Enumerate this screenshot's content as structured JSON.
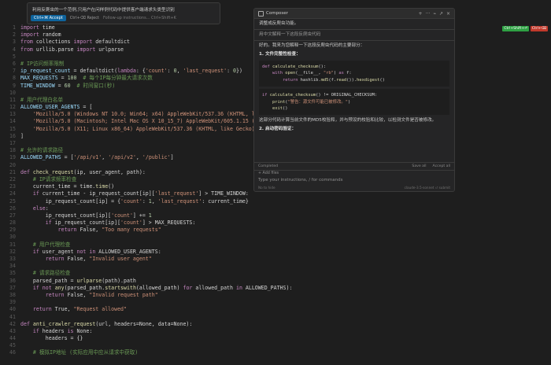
{
  "inline_prompt": {
    "question": "利用反爬虫的一个范例,只用户在问样例代码中提供客户端请求头类型识别",
    "accept_label": "Ctrl+⌘ Accept",
    "reject_label": "Ctrl+⌫ Reject",
    "followup_placeholder": "Follow-up instructions... Ctrl+Shift+K"
  },
  "diff_badges": {
    "accept": "Ctrl+Shift+⏎",
    "reject": "Ctrl+⌫"
  },
  "code_lines": [
    {
      "n": "1",
      "parts": [
        [
          "kw",
          "import"
        ],
        [
          "plain",
          " time"
        ]
      ]
    },
    {
      "n": "2",
      "parts": [
        [
          "kw",
          "import"
        ],
        [
          "plain",
          " random"
        ]
      ]
    },
    {
      "n": "3",
      "parts": [
        [
          "kw",
          "from"
        ],
        [
          "plain",
          " collections "
        ],
        [
          "kw",
          "import"
        ],
        [
          "plain",
          " defaultdict"
        ]
      ]
    },
    {
      "n": "4",
      "parts": [
        [
          "kw",
          "from"
        ],
        [
          "plain",
          " urllib.parse "
        ],
        [
          "kw",
          "import"
        ],
        [
          "plain",
          " urlparse"
        ]
      ]
    },
    {
      "n": "5",
      "parts": []
    },
    {
      "n": "6",
      "parts": [
        [
          "cm",
          "# IP访问频率限制"
        ]
      ]
    },
    {
      "n": "7",
      "parts": [
        [
          "var",
          "ip_request_count"
        ],
        [
          "plain",
          " = defaultdict("
        ],
        [
          "kw",
          "lambda"
        ],
        [
          "plain",
          ": {"
        ],
        [
          "str",
          "'count'"
        ],
        [
          "plain",
          ": "
        ],
        [
          "num",
          "0"
        ],
        [
          "plain",
          ", "
        ],
        [
          "str",
          "'last_request'"
        ],
        [
          "plain",
          ": "
        ],
        [
          "num",
          "0"
        ],
        [
          "plain",
          "})"
        ]
      ]
    },
    {
      "n": "8",
      "parts": [
        [
          "var",
          "MAX_REQUESTS"
        ],
        [
          "plain",
          " = "
        ],
        [
          "num",
          "100"
        ],
        [
          "cm",
          "  # 每个IP每分钟最大请求次数"
        ]
      ]
    },
    {
      "n": "9",
      "parts": [
        [
          "var",
          "TIME_WINDOW"
        ],
        [
          "plain",
          " = "
        ],
        [
          "num",
          "60"
        ],
        [
          "cm",
          "  # 时间窗口(秒)"
        ]
      ]
    },
    {
      "n": "10",
      "parts": []
    },
    {
      "n": "11",
      "parts": [
        [
          "cm",
          "# 用户代理白名单"
        ]
      ]
    },
    {
      "n": "12",
      "parts": [
        [
          "var",
          "ALLOWED_USER_AGENTS"
        ],
        [
          "plain",
          " = ["
        ]
      ]
    },
    {
      "n": "13",
      "parts": [
        [
          "str",
          "    'Mozilla/5.0 (Windows NT 10.0; Win64; x64) AppleWebKit/537.36 (KHTML, lik"
        ]
      ]
    },
    {
      "n": "14",
      "parts": [
        [
          "str",
          "    'Mozilla/5.0 (Macintosh; Intel Mac OS X 10_15_7) AppleWebKit/605.1.15 (KH"
        ]
      ]
    },
    {
      "n": "15",
      "parts": [
        [
          "str",
          "    'Mozilla/5.0 (X11; Linux x86_64) AppleWebKit/537.36 (KHTML, like Gecko) C"
        ]
      ]
    },
    {
      "n": "16",
      "parts": [
        [
          "plain",
          "]"
        ]
      ]
    },
    {
      "n": "17",
      "parts": []
    },
    {
      "n": "18",
      "parts": [
        [
          "cm",
          "# 允许的请求路径"
        ]
      ]
    },
    {
      "n": "19",
      "parts": [
        [
          "var",
          "ALLOWED_PATHS"
        ],
        [
          "plain",
          " = ["
        ],
        [
          "str",
          "'/api/v1'"
        ],
        [
          "plain",
          ", "
        ],
        [
          "str",
          "'/api/v2'"
        ],
        [
          "plain",
          ", "
        ],
        [
          "str",
          "'/public'"
        ],
        [
          "plain",
          "]"
        ]
      ]
    },
    {
      "n": "20",
      "parts": []
    },
    {
      "n": "21",
      "parts": [
        [
          "kw",
          "def"
        ],
        [
          "plain",
          " "
        ],
        [
          "fn",
          "check_request"
        ],
        [
          "plain",
          "(ip, user_agent, path):"
        ]
      ]
    },
    {
      "n": "22",
      "parts": [
        [
          "cm",
          "    # IP请求频率检查"
        ]
      ]
    },
    {
      "n": "23",
      "parts": [
        [
          "plain",
          "    current_time = time."
        ],
        [
          "fn",
          "time"
        ],
        [
          "plain",
          "()"
        ]
      ]
    },
    {
      "n": "24",
      "parts": [
        [
          "kw",
          "    if"
        ],
        [
          "plain",
          " current_time - ip_request_count[ip]["
        ],
        [
          "str",
          "'last_request'"
        ],
        [
          "plain",
          "] > TIME_WINDOW:"
        ]
      ]
    },
    {
      "n": "25",
      "parts": [
        [
          "plain",
          "        ip_request_count[ip] = {"
        ],
        [
          "str",
          "'count'"
        ],
        [
          "plain",
          ": "
        ],
        [
          "num",
          "1"
        ],
        [
          "plain",
          ", "
        ],
        [
          "str",
          "'last_request'"
        ],
        [
          "plain",
          ": current_time}"
        ]
      ]
    },
    {
      "n": "26",
      "parts": [
        [
          "kw",
          "    else"
        ],
        [
          "plain",
          ":"
        ]
      ]
    },
    {
      "n": "27",
      "parts": [
        [
          "plain",
          "        ip_request_count[ip]["
        ],
        [
          "str",
          "'count'"
        ],
        [
          "plain",
          "] += "
        ],
        [
          "num",
          "1"
        ]
      ]
    },
    {
      "n": "28",
      "parts": [
        [
          "kw",
          "        if"
        ],
        [
          "plain",
          " ip_request_count[ip]["
        ],
        [
          "str",
          "'count'"
        ],
        [
          "plain",
          "] > MAX_REQUESTS:"
        ]
      ]
    },
    {
      "n": "29",
      "parts": [
        [
          "kw",
          "            return"
        ],
        [
          "plain",
          " False, "
        ],
        [
          "str",
          "\"Too many requests\""
        ]
      ]
    },
    {
      "n": "30",
      "parts": []
    },
    {
      "n": "31",
      "parts": [
        [
          "cm",
          "    # 用户代理检查"
        ]
      ]
    },
    {
      "n": "32",
      "parts": [
        [
          "kw",
          "    if"
        ],
        [
          "plain",
          " user_agent "
        ],
        [
          "kw",
          "not in"
        ],
        [
          "plain",
          " ALLOWED_USER_AGENTS:"
        ]
      ]
    },
    {
      "n": "33",
      "parts": [
        [
          "kw",
          "        return"
        ],
        [
          "plain",
          " False, "
        ],
        [
          "str",
          "\"Invalid user agent\""
        ]
      ]
    },
    {
      "n": "34",
      "parts": []
    },
    {
      "n": "35",
      "parts": [
        [
          "cm",
          "    # 请求路径检查"
        ]
      ]
    },
    {
      "n": "36",
      "parts": [
        [
          "plain",
          "    parsed_path = "
        ],
        [
          "fn",
          "urlparse"
        ],
        [
          "plain",
          "(path).path"
        ]
      ]
    },
    {
      "n": "37",
      "parts": [
        [
          "kw",
          "    if not"
        ],
        [
          "plain",
          " "
        ],
        [
          "fn",
          "any"
        ],
        [
          "plain",
          "(parsed_path."
        ],
        [
          "fn",
          "startswith"
        ],
        [
          "plain",
          "(allowed_path) "
        ],
        [
          "kw",
          "for"
        ],
        [
          "plain",
          " allowed_path "
        ],
        [
          "kw",
          "in"
        ],
        [
          "plain",
          " ALLOWED_PATHS):"
        ]
      ]
    },
    {
      "n": "38",
      "parts": [
        [
          "kw",
          "        return"
        ],
        [
          "plain",
          " False, "
        ],
        [
          "str",
          "\"Invalid request path\""
        ]
      ]
    },
    {
      "n": "39",
      "parts": []
    },
    {
      "n": "40",
      "parts": [
        [
          "kw",
          "    return"
        ],
        [
          "plain",
          " True, "
        ],
        [
          "str",
          "\"Request allowed\""
        ]
      ]
    },
    {
      "n": "41",
      "parts": []
    },
    {
      "n": "42",
      "parts": [
        [
          "kw",
          "def"
        ],
        [
          "plain",
          " "
        ],
        [
          "fn",
          "anti_crawler_request"
        ],
        [
          "plain",
          "(url, headers=None, data=None):"
        ]
      ]
    },
    {
      "n": "43",
      "parts": [
        [
          "kw",
          "    if"
        ],
        [
          "plain",
          " headers "
        ],
        [
          "kw",
          "is"
        ],
        [
          "plain",
          " None:"
        ]
      ]
    },
    {
      "n": "44",
      "parts": [
        [
          "plain",
          "        headers = {}"
        ]
      ]
    },
    {
      "n": "45",
      "parts": []
    },
    {
      "n": "46",
      "parts": [
        [
          "cm",
          "    # 模拟IP地址 (实际应用中应从请求中获取)"
        ]
      ]
    }
  ],
  "composer": {
    "title": "Composer",
    "controls": [
      "+",
      "···",
      "⌁",
      "↗",
      "×"
    ],
    "user_msg_1": "调整成反爬虫功能。",
    "user_msg_2": "用中文解释一下这段反爬虫代码",
    "intro": "好的。我来为您解释一下这段反爬虫代码的主要部分：",
    "section_1": "1. 文件完整性检查：",
    "code_block_1": [
      [
        [
          "kw",
          "def"
        ],
        [
          "plain",
          " "
        ],
        [
          "fn",
          "calculate_checksum"
        ],
        [
          "plain",
          "():"
        ]
      ],
      [
        [
          "kw",
          "    with"
        ],
        [
          "plain",
          " "
        ],
        [
          "fn",
          "open"
        ],
        [
          "plain",
          "(__file__, "
        ],
        [
          "str",
          "\"rb\""
        ],
        [
          "plain",
          ") "
        ],
        [
          "kw",
          "as"
        ],
        [
          "plain",
          " f:"
        ]
      ],
      [
        [
          "kw",
          "        return"
        ],
        [
          "plain",
          " hashlib."
        ],
        [
          "fn",
          "md5"
        ],
        [
          "plain",
          "(f."
        ],
        [
          "fn",
          "read"
        ],
        [
          "plain",
          "())."
        ],
        [
          "fn",
          "hexdigest"
        ],
        [
          "plain",
          "()"
        ]
      ]
    ],
    "code_block_2": [
      [
        [
          "kw",
          "if"
        ],
        [
          "plain",
          " "
        ],
        [
          "fn",
          "calculate_checksum"
        ],
        [
          "plain",
          "() != ORIGINAL_CHECKSUM:"
        ]
      ],
      [
        [
          "fn",
          "    print"
        ],
        [
          "plain",
          "("
        ],
        [
          "str",
          "\"警告：源文件可能已被修改。\""
        ],
        [
          "plain",
          ")"
        ]
      ],
      [
        [
          "fn",
          "    exit"
        ],
        [
          "plain",
          "()"
        ]
      ]
    ],
    "explain": "这部分代码计算当前文件的MD5校验和，并与预设的校验和比较，以检测文件是否被修改。",
    "section_2": "2. 启动密码验证：",
    "status": "Completed",
    "save_all": "Save all",
    "accept_all": "Accept all",
    "add_files": "Add files",
    "input_placeholder": "Type your instructions, / for commands",
    "foot_left": "No to hide",
    "foot_right": "claude-3.5-sonnet  ⏎ submit"
  }
}
